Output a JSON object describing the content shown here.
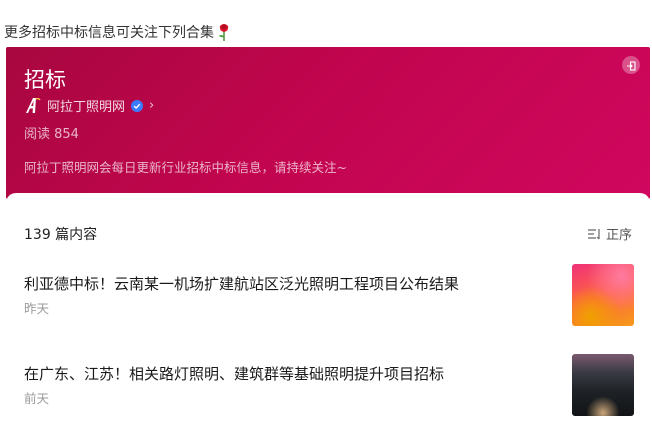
{
  "intro": {
    "text": "更多招标中标信息可关注下列合集"
  },
  "banner": {
    "title": "招标",
    "author": "阿拉丁照明网",
    "read_count": "阅读 854",
    "description": "阿拉丁照明网会每日更新行业招标中标信息，请持续关注~",
    "bg_color": "#c1054e"
  },
  "list": {
    "count_label": "139 篇内容",
    "sort_label": "正序",
    "items": [
      {
        "title": "利亚德中标！云南某一机场扩建航站区泛光照明工程项目公布结果",
        "time": "昨天"
      },
      {
        "title": "在广东、江苏！相关路灯照明、建筑群等基础照明提升项目招标",
        "time": "前天"
      }
    ]
  }
}
